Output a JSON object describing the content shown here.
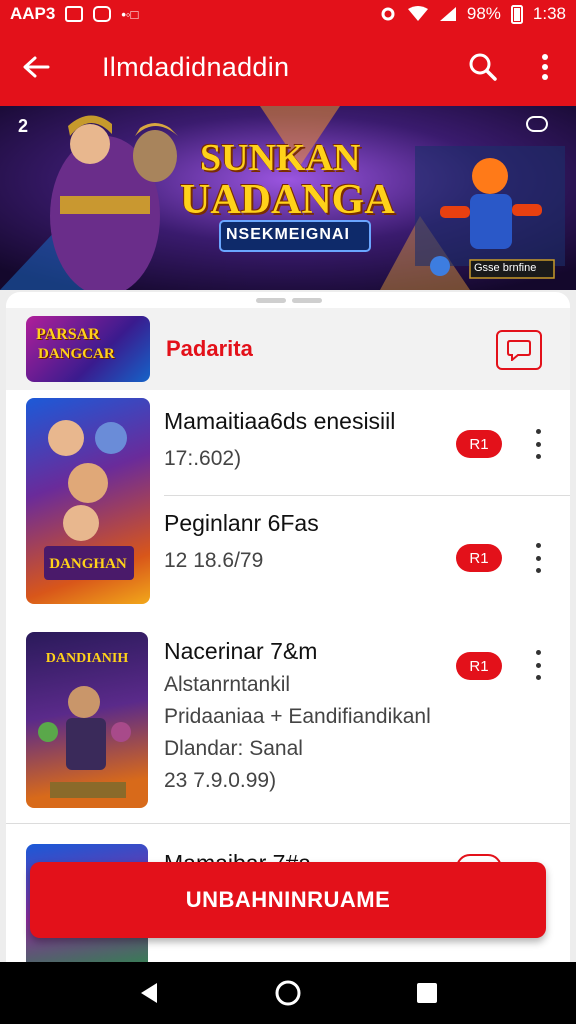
{
  "status_bar": {
    "left_text": "AAP3",
    "battery": "98%",
    "time": "1:38"
  },
  "app_bar": {
    "title": "Ilmdadidnaddin",
    "back_icon": "arrow-left-icon",
    "search_icon": "search-icon",
    "menu_icon": "more-vert-icon"
  },
  "banner": {
    "headline_1": "SUNKAN",
    "headline_2": "UADANGA",
    "subtitle": "NSEKMEIGNAI",
    "corner_label": "2",
    "bottom_label": "Gsse brnfine"
  },
  "featured": {
    "thumb_text_1": "PARSAR",
    "thumb_text_2": "DANGCAR",
    "name": "Padarita",
    "action_icon": "chat-icon"
  },
  "items": [
    {
      "title": "Mamaitiaa6ds enesisiil",
      "subtitle": "17:.602)",
      "badge": "R1"
    },
    {
      "title": "Peginlanr 6Fas",
      "subtitle": "12 18.6/79",
      "badge": "R1"
    },
    {
      "title": "Nacerinar 7&m",
      "line2": "Alstanrntankil",
      "line3": "Pridaaniaa + Eandifiandikanl",
      "line4": "Dlandar: Sanal",
      "line5": "23 7.9.0.99)",
      "badge": "R1",
      "thumb_text": "DANDIANIH"
    },
    {
      "title": "Mamaibar 7#a",
      "badge": "R1"
    }
  ],
  "cta": {
    "label": "UNBAHNINRUAME"
  },
  "colors": {
    "accent": "#e3111a"
  }
}
